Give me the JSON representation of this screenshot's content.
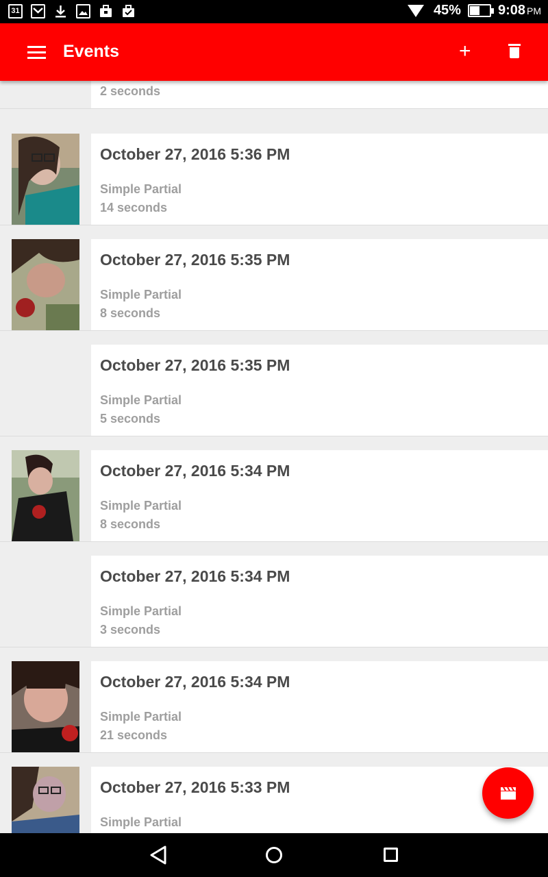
{
  "status_bar": {
    "calendar_day": "31",
    "battery_percent": "45%",
    "battery_level": 0.45,
    "time": "9:08",
    "time_suffix": "PM",
    "left_icons": [
      "calendar-icon",
      "gmail-icon",
      "download-icon",
      "image-icon",
      "briefcase-icon",
      "briefcase-check-icon"
    ]
  },
  "app_bar": {
    "title": "Events",
    "add_icon": "+",
    "color": "#ff0000"
  },
  "events": [
    {
      "title": "",
      "type": "Simple Partial",
      "duration": "2 seconds",
      "thumb": "none"
    },
    {
      "title": "October 27, 2016 5:36 PM",
      "type": "Simple Partial",
      "duration": "14 seconds",
      "thumb": "photo"
    },
    {
      "title": "October 27, 2016 5:35 PM",
      "type": "Simple Partial",
      "duration": "8 seconds",
      "thumb": "photo"
    },
    {
      "title": "October 27, 2016 5:35 PM",
      "type": "Simple Partial",
      "duration": "5 seconds",
      "thumb": "none"
    },
    {
      "title": "October 27, 2016 5:34 PM",
      "type": "Simple Partial",
      "duration": "8 seconds",
      "thumb": "photo"
    },
    {
      "title": "October 27, 2016 5:34 PM",
      "type": "Simple Partial",
      "duration": "3 seconds",
      "thumb": "none"
    },
    {
      "title": "October 27, 2016 5:34 PM",
      "type": "Simple Partial",
      "duration": "21 seconds",
      "thumb": "photo"
    },
    {
      "title": "October 27, 2016 5:33 PM",
      "type": "Simple Partial",
      "duration": "",
      "thumb": "photo"
    }
  ],
  "fab": {
    "icon": "clapperboard-icon"
  },
  "nav_bar": {
    "icons": [
      "back-icon",
      "home-icon",
      "recents-icon"
    ]
  }
}
